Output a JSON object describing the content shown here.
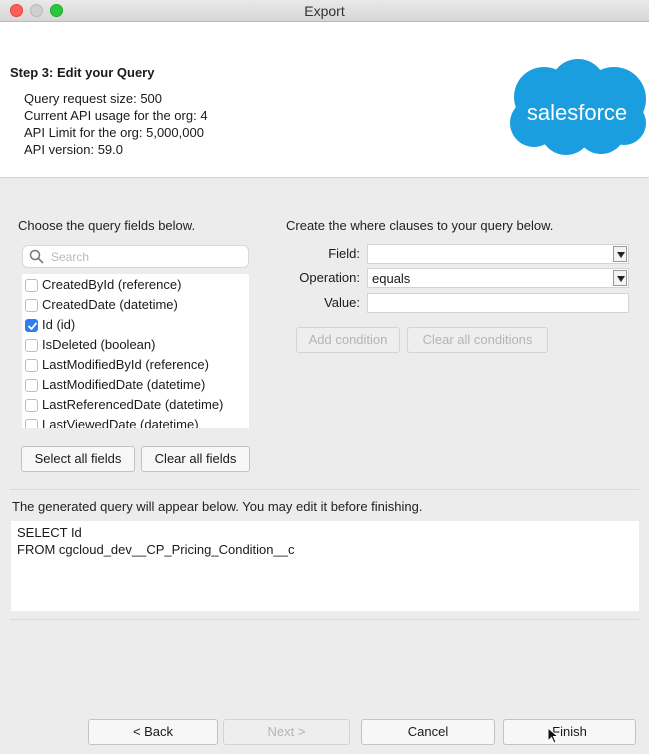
{
  "window": {
    "title": "Export"
  },
  "header": {
    "step_title": "Step 3: Edit your Query",
    "info": [
      "Query request size: 500",
      "Current API usage for the org: 4",
      "API Limit for the org: 5,000,000",
      "API version: 59.0"
    ],
    "logo_text": "salesforce",
    "logo_color": "#1b9ee0"
  },
  "fields_panel": {
    "label": "Choose the query fields below.",
    "search_placeholder": "Search",
    "items": [
      {
        "label": "CreatedById (reference)",
        "checked": false
      },
      {
        "label": "CreatedDate (datetime)",
        "checked": false
      },
      {
        "label": "Id (id)",
        "checked": true
      },
      {
        "label": "IsDeleted (boolean)",
        "checked": false
      },
      {
        "label": "LastModifiedById (reference)",
        "checked": false
      },
      {
        "label": "LastModifiedDate (datetime)",
        "checked": false
      },
      {
        "label": "LastReferencedDate (datetime)",
        "checked": false
      },
      {
        "label": "LastViewedDate (datetime)",
        "checked": false
      }
    ],
    "select_all_label": "Select all fields",
    "clear_all_label": "Clear all fields"
  },
  "where_panel": {
    "label": "Create the where clauses to your query below.",
    "field_label": "Field:",
    "field_value": "",
    "operation_label": "Operation:",
    "operation_value": "equals",
    "value_label": "Value:",
    "value_value": "",
    "add_condition_label": "Add condition",
    "clear_conditions_label": "Clear all conditions"
  },
  "query": {
    "label": "The generated query will appear below.  You may edit it before finishing.",
    "text": "SELECT Id\nFROM cgcloud_dev__CP_Pricing_Condition__c"
  },
  "footer": {
    "back_label": "< Back",
    "next_label": "Next >",
    "cancel_label": "Cancel",
    "finish_label": "Finish"
  },
  "colors": {
    "checkbox_checked": "#2e7cf6"
  }
}
